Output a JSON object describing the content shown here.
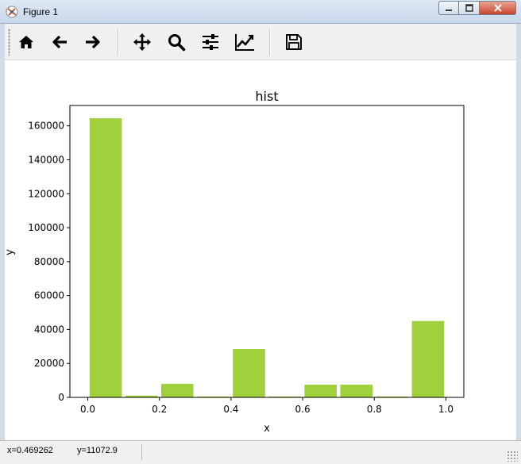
{
  "window": {
    "title": "Figure 1"
  },
  "toolbar": {
    "tools": [
      {
        "name": "home-icon"
      },
      {
        "name": "back-arrow-icon"
      },
      {
        "name": "forward-arrow-icon"
      },
      {
        "name": "pan-move-icon"
      },
      {
        "name": "zoom-magnifier-icon"
      },
      {
        "name": "configure-subplots-icon"
      },
      {
        "name": "edit-axis-icon"
      },
      {
        "name": "save-floppy-icon"
      }
    ]
  },
  "chart_data": {
    "type": "bar",
    "title": "hist",
    "xlabel": "x",
    "ylabel": "y",
    "xlim": [
      -0.05,
      1.05
    ],
    "ylim": [
      0,
      172000
    ],
    "xticks": [
      "0.0",
      "0.2",
      "0.4",
      "0.6",
      "0.8",
      "1.0"
    ],
    "yticks": [
      "0",
      "20000",
      "40000",
      "60000",
      "80000",
      "100000",
      "120000",
      "140000",
      "160000"
    ],
    "bins": [
      {
        "start": 0.0,
        "end": 0.1,
        "value": 164500
      },
      {
        "start": 0.1,
        "end": 0.2,
        "value": 1000
      },
      {
        "start": 0.2,
        "end": 0.3,
        "value": 8000
      },
      {
        "start": 0.3,
        "end": 0.4,
        "value": 500
      },
      {
        "start": 0.4,
        "end": 0.5,
        "value": 28500
      },
      {
        "start": 0.5,
        "end": 0.6,
        "value": 500
      },
      {
        "start": 0.6,
        "end": 0.7,
        "value": 7500
      },
      {
        "start": 0.7,
        "end": 0.8,
        "value": 7500
      },
      {
        "start": 0.8,
        "end": 0.9,
        "value": 500
      },
      {
        "start": 0.9,
        "end": 1.0,
        "value": 45000
      }
    ],
    "bar_color": "#a0d03c",
    "grid": false
  },
  "status": {
    "x": "x=0.469262",
    "y": "y=11072.9"
  }
}
